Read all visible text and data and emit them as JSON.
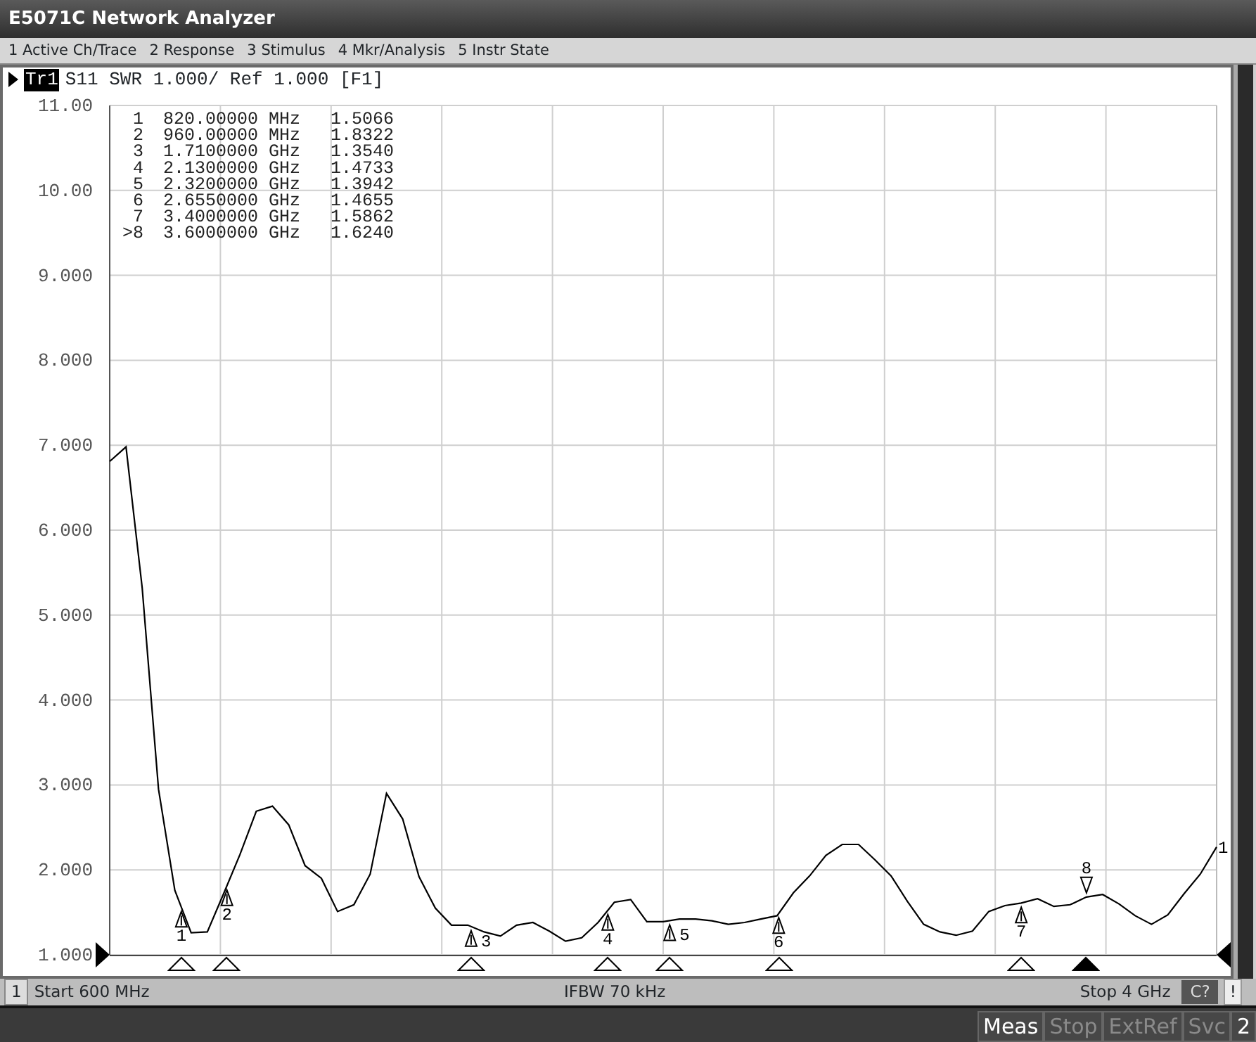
{
  "window": {
    "title": "E5071C Network Analyzer"
  },
  "menu": [
    "1 Active Ch/Trace",
    "2 Response",
    "3 Stimulus",
    "4 Mkr/Analysis",
    "5 Instr State"
  ],
  "trace_header": {
    "tag": "Tr1",
    "active": true,
    "text": "S11 SWR 1.000/ Ref 1.000 [F1]"
  },
  "marker_table": [
    {
      "marker": "1",
      "stimulus": "820.00000 MHz",
      "value": "1.5066",
      "active": false,
      "level": 0.0647
    },
    {
      "marker": "2",
      "stimulus": "960.00000 MHz",
      "value": "1.8322",
      "active": false,
      "level": 0.1059
    },
    {
      "marker": "3",
      "stimulus": "1.7100000 GHz",
      "value": "1.3540",
      "active": false,
      "level": 0.3265
    },
    {
      "marker": "4",
      "stimulus": "2.1300000 GHz",
      "value": "1.4733",
      "active": false,
      "level": 0.45
    },
    {
      "marker": "5",
      "stimulus": "2.3200000 GHz",
      "value": "1.3942",
      "active": false,
      "level": 0.5059
    },
    {
      "marker": "6",
      "stimulus": "2.6550000 GHz",
      "value": "1.4655",
      "active": false,
      "level": 0.6044
    },
    {
      "marker": "7",
      "stimulus": "3.4000000 GHz",
      "value": "1.5862",
      "active": false,
      "level": 0.8235
    },
    {
      "marker": ">8",
      "stimulus": "3.6000000 GHz",
      "value": "1.6240",
      "active": true,
      "level": 0.8824
    }
  ],
  "chart_data": {
    "type": "line",
    "ylim": [
      1,
      11
    ],
    "grid": true,
    "yticks": [
      {
        "value": 11,
        "label": "11.00"
      },
      {
        "value": 10,
        "label": "10.00"
      },
      {
        "value": 9,
        "label": "9.000"
      },
      {
        "value": 8,
        "label": "8.000"
      },
      {
        "value": 7,
        "label": "7.000"
      },
      {
        "value": 6,
        "label": "6.000"
      },
      {
        "value": 5,
        "label": "5.000"
      },
      {
        "value": 4,
        "label": "4.000"
      },
      {
        "value": 3,
        "label": "3.000"
      },
      {
        "value": 2,
        "label": "2.000"
      },
      {
        "value": 1,
        "label": "1.000"
      }
    ],
    "categories": [
      null,
      null,
      null,
      null,
      null,
      null,
      null,
      null,
      null,
      null,
      null,
      null,
      null,
      null,
      null,
      null,
      null,
      null,
      null,
      null,
      null,
      null,
      null,
      null,
      null,
      null,
      null,
      null,
      null,
      null,
      null,
      null,
      null,
      null,
      null,
      null,
      null,
      null,
      null,
      null,
      null,
      null,
      null,
      null,
      null,
      null,
      null,
      null,
      null,
      null,
      null,
      null,
      null,
      null,
      null,
      null,
      null,
      null,
      null,
      null,
      null,
      null,
      null,
      null,
      null,
      null,
      null,
      null,
      null
    ],
    "series": [
      {
        "name": "1",
        "color": "#000000",
        "values": [
          6.81,
          6.98,
          5.32,
          2.95,
          1.76,
          1.26,
          1.27,
          1.72,
          2.18,
          2.69,
          2.75,
          2.53,
          2.05,
          1.9,
          1.51,
          1.59,
          1.95,
          2.9,
          2.6,
          1.92,
          1.55,
          1.35,
          1.35,
          1.27,
          1.22,
          1.35,
          1.38,
          1.28,
          1.16,
          1.2,
          1.38,
          1.62,
          1.65,
          1.39,
          1.39,
          1.42,
          1.42,
          1.4,
          1.36,
          1.38,
          1.42,
          1.46,
          1.73,
          1.93,
          2.17,
          2.3,
          2.3,
          2.12,
          1.93,
          1.63,
          1.36,
          1.27,
          1.23,
          1.28,
          1.51,
          1.58,
          1.61,
          1.66,
          1.57,
          1.59,
          1.68,
          1.71,
          1.6,
          1.46,
          1.36,
          1.47,
          1.72,
          1.95,
          2.27
        ]
      }
    ],
    "annotations": [
      "1",
      "2",
      "3",
      "4",
      "5",
      "6",
      "7",
      "8"
    ]
  },
  "status_bar": {
    "channel": "1",
    "start": "Start 600 MHz",
    "ifbw": "IFBW 70 kHz",
    "stop": "Stop 4 GHz",
    "cal": "C?",
    "warning": "!"
  },
  "softkeys": [
    {
      "label": "Meas",
      "enabled": true
    },
    {
      "label": "Stop",
      "enabled": false
    },
    {
      "label": "ExtRef",
      "enabled": false
    },
    {
      "label": "Svc",
      "enabled": false
    },
    {
      "label": "2",
      "enabled": true
    }
  ]
}
